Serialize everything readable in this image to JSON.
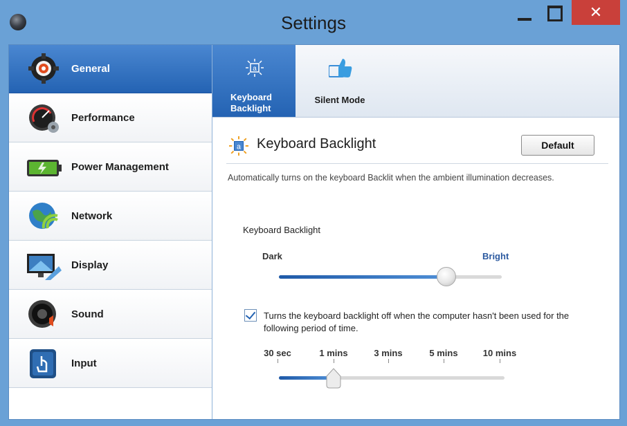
{
  "window": {
    "title": "Settings",
    "close_glyph": "✕",
    "colors": {
      "frame": "#6aa1d6",
      "accent": "#2463b3",
      "close": "#c9403a"
    }
  },
  "sidebar": {
    "items": [
      {
        "label": "General",
        "icon": "gear-icon",
        "active": true
      },
      {
        "label": "Performance",
        "icon": "speedometer-icon",
        "active": false
      },
      {
        "label": "Power Management",
        "icon": "battery-icon",
        "active": false
      },
      {
        "label": "Network",
        "icon": "globe-wifi-icon",
        "active": false
      },
      {
        "label": "Display",
        "icon": "monitor-icon",
        "active": false
      },
      {
        "label": "Sound",
        "icon": "speaker-icon",
        "active": false
      },
      {
        "label": "Input",
        "icon": "touch-icon",
        "active": false
      }
    ]
  },
  "tabs": [
    {
      "label": "Keyboard Backlight",
      "icon": "keyboard-backlight-icon",
      "active": true
    },
    {
      "label": "Silent Mode",
      "icon": "thumbs-up-icon",
      "active": false
    }
  ],
  "panel": {
    "title": "Keyboard Backlight",
    "default_button": "Default",
    "description": "Automatically turns on the keyboard Backlit when the ambient illumination decreases.",
    "brightness": {
      "label": "Keyboard Backlight",
      "min_label": "Dark",
      "max_label": "Bright",
      "value_fraction": 0.75
    },
    "timeout": {
      "enabled": true,
      "checkbox_text": "Turns the keyboard backlight off when the computer hasn't been used for the following period of time.",
      "options": [
        "30 sec",
        "1 mins",
        "3 mins",
        "5 mins",
        "10 mins"
      ],
      "selected": "1 mins"
    }
  }
}
